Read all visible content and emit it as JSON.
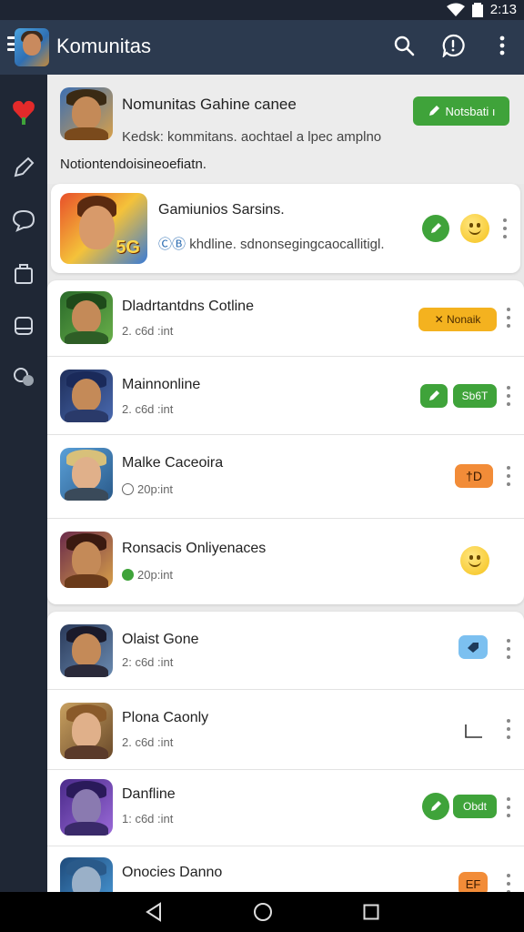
{
  "status_bar": {
    "time": "2:13"
  },
  "app_bar": {
    "title": "Komunitas"
  },
  "header": {
    "title": "Nomunitas Gahine canee",
    "subtitle": "Kedsk: kommitans. aochtael a lpec amplno",
    "note": "Notiontendoisineoefiatn.",
    "button_label": "Notsbati ı"
  },
  "featured": {
    "title": "Gamiunios Sarsins.",
    "subtitle": "khdline. sdnonsegingcaocallitigl.",
    "sub_prefix": "ⒸⒷ",
    "thumb_text": "5G"
  },
  "rows": [
    {
      "title": "Dladrtantdns Cotline",
      "sub": "2. c6d :int",
      "badge": "✕ Nonaik",
      "badge_color": "#f4b21f"
    },
    {
      "title": "Mainnonline",
      "sub": "2. c6d :int",
      "badge": "Sb6T",
      "badge_color": "#3fa33a"
    },
    {
      "title": "Malke Caceoira",
      "sub": "20p:int",
      "badge": "†D",
      "badge_color": "#f28c38"
    },
    {
      "title": "Ronsacis Onliyenaces",
      "sub": "20p:int"
    },
    {
      "title": "Olaist Gone",
      "sub": "2: c6d :int"
    },
    {
      "title": "Plona Caonly",
      "sub": "2. c6d :int"
    },
    {
      "title": "Danfline",
      "sub": "1: c6d :int",
      "badge": "Obdt",
      "badge_color": "#3fa33a"
    },
    {
      "title": "Onocies Danno",
      "sub": "",
      "badge": "EF",
      "badge_color": "#f28c38"
    }
  ],
  "colors": {
    "appbar": "#2c3a4f",
    "sidebar": "#1f2735",
    "green": "#3fa33a",
    "orange": "#f28c38",
    "yellow": "#f4b21f"
  }
}
